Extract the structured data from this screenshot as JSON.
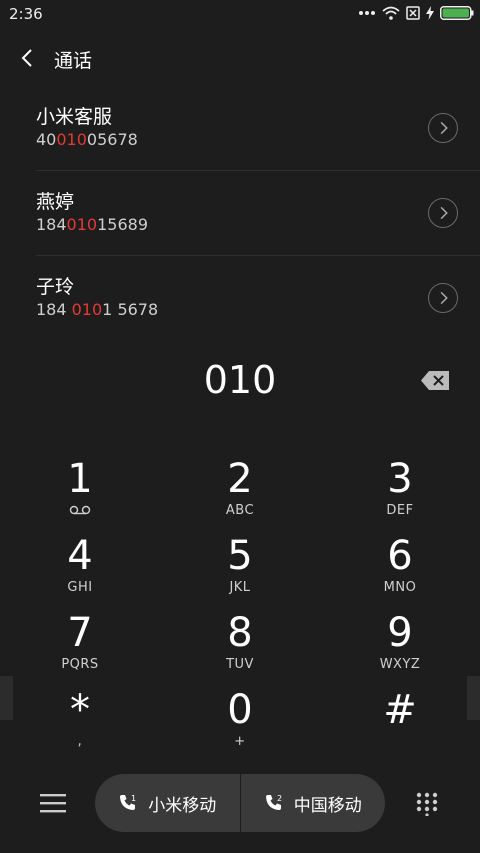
{
  "status": {
    "time": "2:36"
  },
  "header": {
    "title": "通话"
  },
  "contacts": [
    {
      "name": "小米客服",
      "num_pre": "40",
      "num_hl": "010",
      "num_post": "05678"
    },
    {
      "name": "燕婷",
      "num_pre": "184",
      "num_hl": "010",
      "num_post": "15689"
    },
    {
      "name": "子玲",
      "num_pre": "184 ",
      "num_hl": "010",
      "num_post": "1 5678"
    }
  ],
  "dialer": {
    "input": "010"
  },
  "keys": [
    {
      "digit": "1",
      "letters": ""
    },
    {
      "digit": "2",
      "letters": "ABC"
    },
    {
      "digit": "3",
      "letters": "DEF"
    },
    {
      "digit": "4",
      "letters": "GHI"
    },
    {
      "digit": "5",
      "letters": "JKL"
    },
    {
      "digit": "6",
      "letters": "MNO"
    },
    {
      "digit": "7",
      "letters": "PQRS"
    },
    {
      "digit": "8",
      "letters": "TUV"
    },
    {
      "digit": "9",
      "letters": "WXYZ"
    },
    {
      "digit": "*",
      "letters": ","
    },
    {
      "digit": "0",
      "letters": "+"
    },
    {
      "digit": "#",
      "letters": ""
    }
  ],
  "sims": [
    {
      "label": "小米移动",
      "slot": "1"
    },
    {
      "label": "中国移动",
      "slot": "2"
    }
  ],
  "icons": {
    "back": "chevron-left-icon",
    "voicemail": "voicemail-icon",
    "backspace": "backspace-icon",
    "menu": "menu-icon",
    "dialpad": "dialpad-icon"
  },
  "colors": {
    "background": "#1d1d1d",
    "highlight": "#e53935",
    "pill": "#3a3a3a",
    "battery": "#4caf50"
  }
}
